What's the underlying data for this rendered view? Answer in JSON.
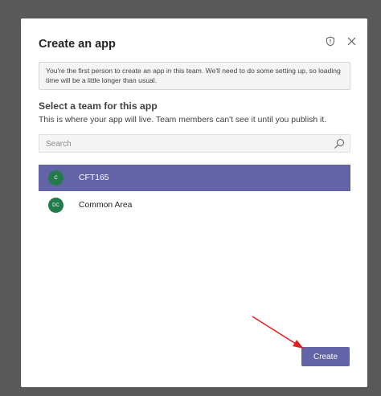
{
  "dialog": {
    "title": "Create an app",
    "notice": "You're the first person to create an app in this team. We'll need to do some setting up, so loading time will be a little longer than usual.",
    "section_title": "Select a team for this app",
    "section_subtitle": "This is where your app will live. Team members can't see it until you publish it.",
    "search": {
      "placeholder": "Search",
      "value": ""
    },
    "teams": [
      {
        "initials": "C",
        "name": "CFT165",
        "selected": true
      },
      {
        "initials": "DC",
        "name": "Common Area",
        "selected": false
      }
    ],
    "create_label": "Create"
  },
  "icons": {
    "privacy": "shield-icon",
    "close": "close-icon",
    "search": "search-icon"
  },
  "colors": {
    "accent": "#6264a7",
    "avatar": "#237b4b",
    "annotation_arrow": "#e02020",
    "backdrop": "#595959"
  }
}
